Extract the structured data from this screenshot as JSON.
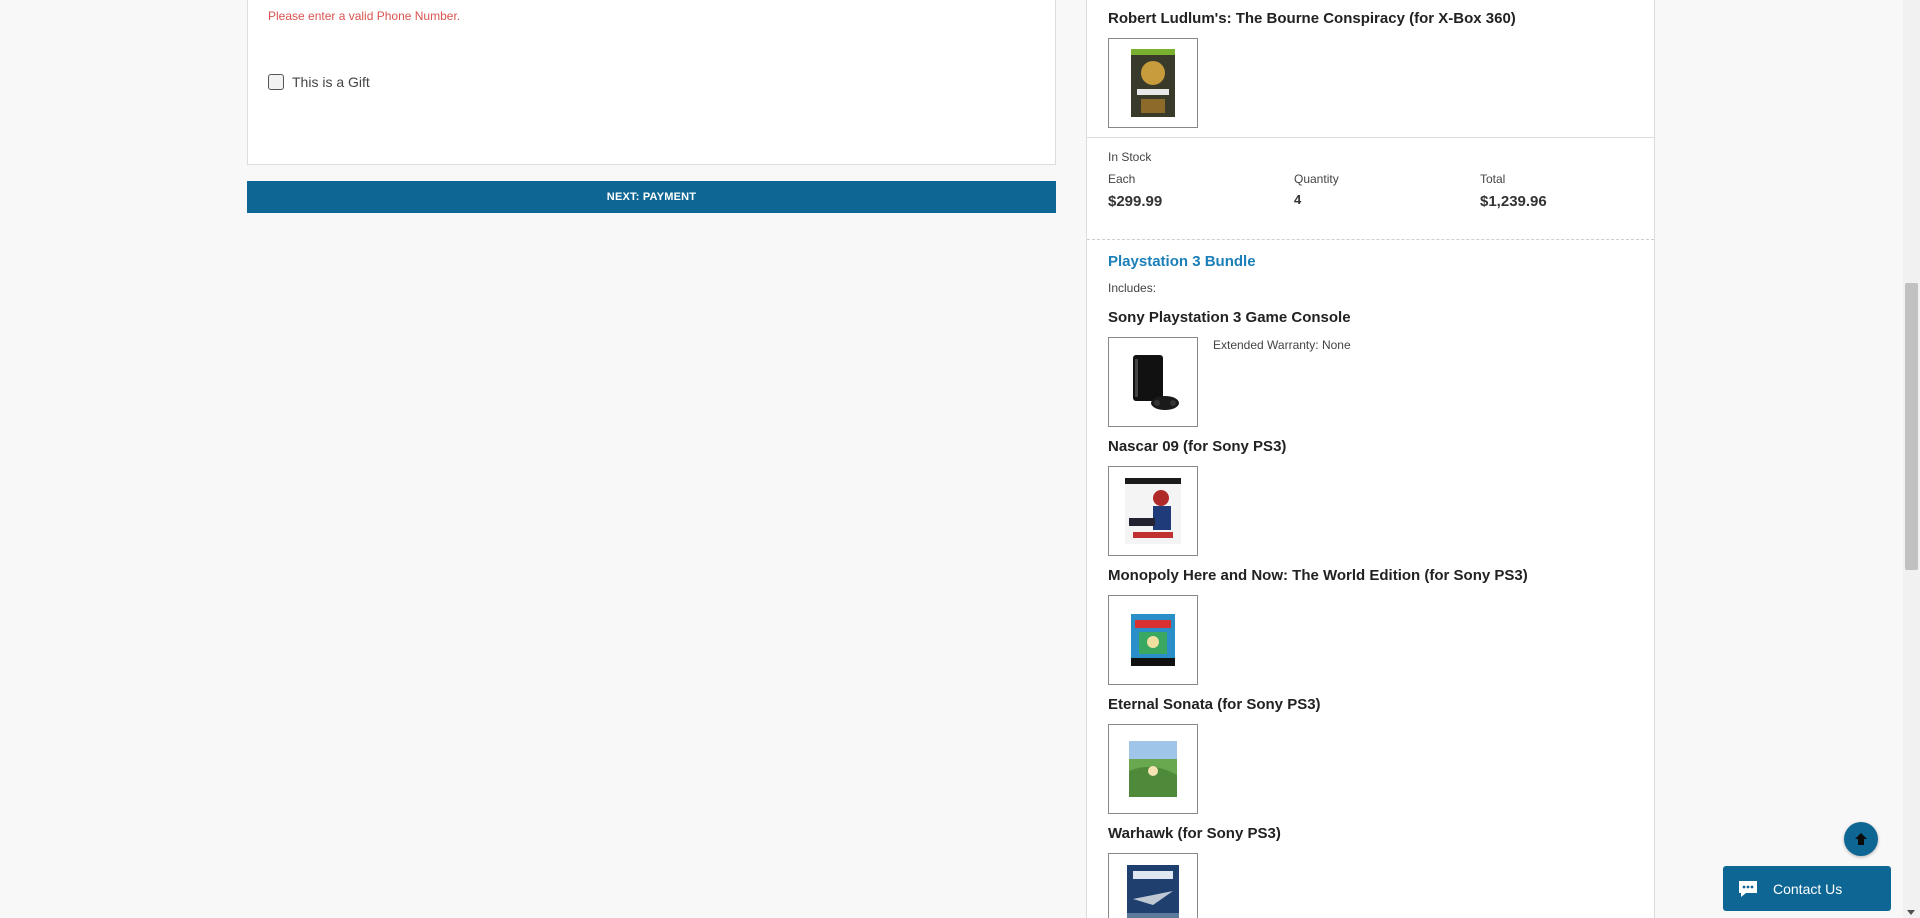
{
  "form": {
    "phone_error": "Please enter a valid Phone Number.",
    "gift_label": "This is a Gift",
    "gift_checked": false,
    "next_button": "NEXT: PAYMENT"
  },
  "summary": {
    "first_item": {
      "title": "Robert Ludlum's: The Bourne Conspiracy (for X-Box 360)",
      "thumb_icon": "bourne-cover-image"
    },
    "stock_status": "In Stock",
    "each_label": "Each",
    "each_value": "$299.99",
    "quantity_label": "Quantity",
    "quantity_value": "4",
    "total_label": "Total",
    "total_value": "$1,239.96",
    "bundle": {
      "title": "Playstation 3 Bundle",
      "includes_label": "Includes:",
      "items": [
        {
          "title": "Sony Playstation 3 Game Console",
          "note": "Extended Warranty: None",
          "thumb_icon": "ps3-console-image"
        },
        {
          "title": "Nascar 09 (for Sony PS3)",
          "thumb_icon": "nascar-cover-image"
        },
        {
          "title": "Monopoly Here and Now: The World Edition (for Sony PS3)",
          "thumb_icon": "monopoly-cover-image"
        },
        {
          "title": "Eternal Sonata (for Sony PS3)",
          "thumb_icon": "eternal-sonata-cover-image"
        },
        {
          "title": "Warhawk (for Sony PS3)",
          "thumb_icon": "warhawk-cover-image"
        }
      ]
    }
  },
  "floating": {
    "contact_label": "Contact Us",
    "back_to_top_icon": "arrow-up-icon",
    "chat_icon": "chat-bubble-icon"
  },
  "colors": {
    "primary": "#0e6694",
    "link": "#1b7fb8",
    "error": "#d9534f"
  }
}
